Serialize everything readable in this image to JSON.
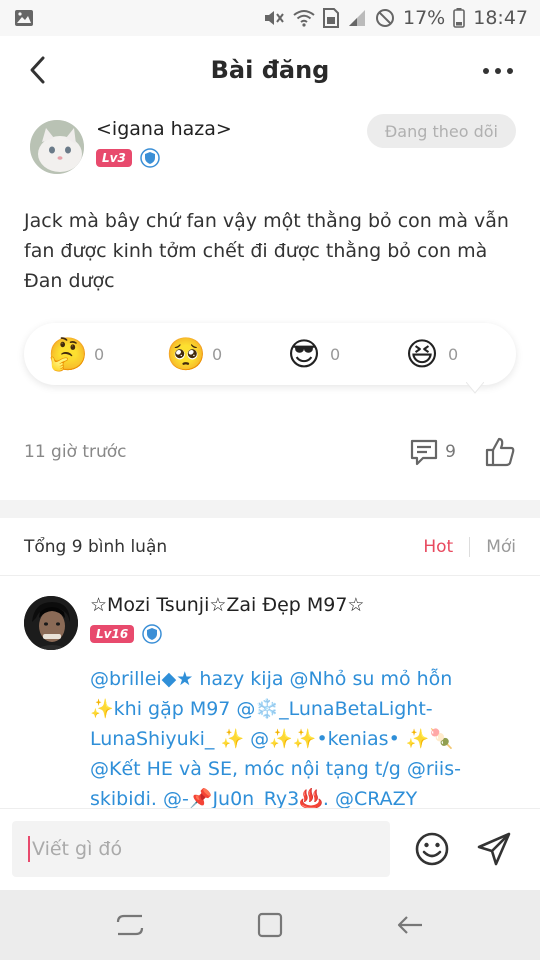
{
  "status_bar": {
    "battery": "17%",
    "time": "18:47",
    "icons": [
      "image-icon",
      "mute-icon",
      "wifi-icon",
      "sim-icon",
      "signal-icon",
      "no-disturb-icon",
      "battery-icon"
    ]
  },
  "header": {
    "title": "Bài đăng"
  },
  "post": {
    "author_name": "<igana haza>",
    "level": "Lv3",
    "follow_label": "Đang theo dõi",
    "text": "Jack mà bây chứ fan vậy một thằng bỏ con mà vẫn fan được kinh tởm chết đi được thằng bỏ con mà Đan dược",
    "reactions": [
      {
        "emoji": "🤔",
        "count": "0"
      },
      {
        "emoji": "🥺",
        "count": "0"
      },
      {
        "emoji": "😎",
        "count": "0"
      },
      {
        "emoji": "😆",
        "count": "0"
      }
    ],
    "time_ago": "11 giờ trước",
    "comment_count": "9"
  },
  "comments": {
    "total_label": "Tổng 9 bình luận",
    "sort_hot": "Hot",
    "sort_new": "Mới",
    "items": [
      {
        "name": "☆Mozi Tsunji☆Zai Đẹp M97☆",
        "level": "Lv16",
        "text": "@brillei◆★ hazy kija @Nhỏ su mỏ hỗn ✨khi gặp M97 @❄️_LunaBetaLight-LunaShiyuki_ ✨ @✨✨•kenias• ✨🍡 @Kết HE và SE, móc nội tạng t/g @riis-skibidi. @-📌Ju0n_Ry3♨️. @CRAZY QUEEN☠️ @^kymi"
      }
    ]
  },
  "input": {
    "placeholder": "Viết gì đó"
  },
  "colors": {
    "accent": "#e84a5f",
    "level_badge": "#e84a6d",
    "mention": "#2f8fd8"
  }
}
